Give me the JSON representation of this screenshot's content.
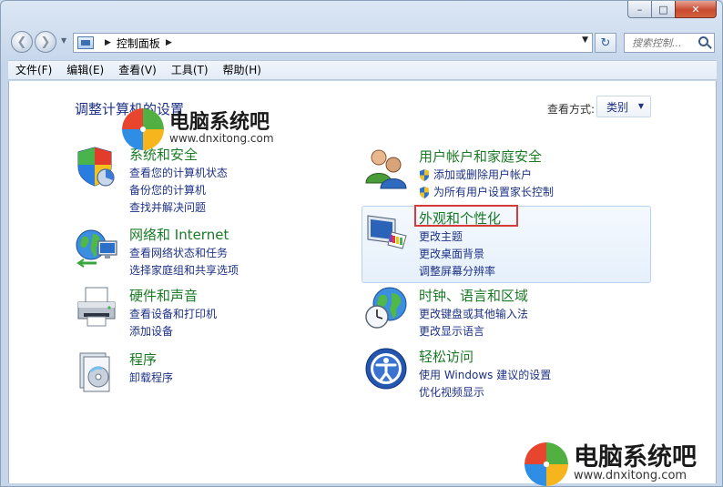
{
  "window": {
    "caption_minimize": "–",
    "caption_maximize": "□",
    "caption_close": "✕"
  },
  "nav": {
    "back_glyph": "❮",
    "forward_glyph": "❯",
    "breadcrumb": "控制面板",
    "search_placeholder": "搜索控制..."
  },
  "menu": [
    "文件(F)",
    "编辑(E)",
    "查看(V)",
    "工具(T)",
    "帮助(H)"
  ],
  "page": {
    "title": "调整计算机的设置",
    "view_by_label": "查看方式:",
    "view_by_value": "类别"
  },
  "categories": [
    {
      "id": "system-security",
      "icon": "shield-pie-icon",
      "title": "系统和安全",
      "links": [
        "查看您的计算机状态",
        "备份您的计算机",
        "查找并解决问题"
      ]
    },
    {
      "id": "network-internet",
      "icon": "globe-network-icon",
      "title": "网络和 Internet",
      "links": [
        "查看网络状态和任务",
        "选择家庭组和共享选项"
      ]
    },
    {
      "id": "hardware-sound",
      "icon": "printer-icon",
      "title": "硬件和声音",
      "links": [
        "查看设备和打印机",
        "添加设备"
      ]
    },
    {
      "id": "programs",
      "icon": "programs-icon",
      "title": "程序",
      "links": [
        "卸载程序"
      ]
    },
    {
      "id": "user-accounts",
      "icon": "users-icon",
      "title": "用户帐户和家庭安全",
      "links": [
        "添加或删除用户帐户",
        "为所有用户设置家长控制"
      ]
    },
    {
      "id": "appearance",
      "icon": "monitor-palette-icon",
      "title": "外观和个性化",
      "links": [
        "更改主题",
        "更改桌面背景",
        "调整屏幕分辨率"
      ]
    },
    {
      "id": "clock-region",
      "icon": "clock-globe-icon",
      "title": "时钟、语言和区域",
      "links": [
        "更改键盘或其他输入法",
        "更改显示语言"
      ]
    },
    {
      "id": "ease-of-access",
      "icon": "ease-access-icon",
      "title": "轻松访问",
      "links": [
        "使用 Windows 建议的设置",
        "优化视频显示"
      ]
    }
  ],
  "watermark": {
    "name": "电脑系统吧",
    "url": "www.dnxitong.com"
  },
  "colors": {
    "category_title": "#1a7a26",
    "link": "#1e3287",
    "highlight_border": "#d63a3a"
  }
}
